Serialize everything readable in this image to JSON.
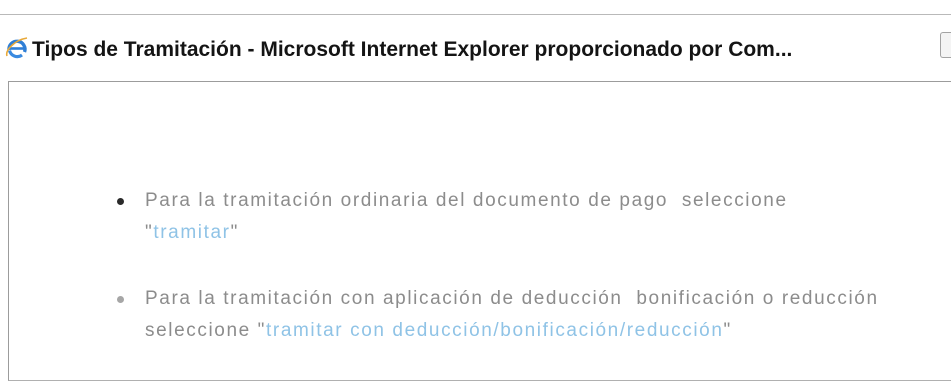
{
  "window": {
    "title": "Tipos de Tramitación - Microsoft Internet Explorer proporcionado por Com...",
    "icon": "internet-explorer-icon"
  },
  "content": {
    "items": [
      {
        "text": "Para la tramitación ordinaria del documento de pago  seleccione",
        "prefix": "\"",
        "link": "tramitar",
        "suffix": "\""
      },
      {
        "text": "Para la tramitación con aplicación de deducción  bonificación o reducción",
        "prefix": "seleccione \"",
        "link": "tramitar con deducción/bonificación/reducción",
        "suffix": "\""
      }
    ]
  },
  "colors": {
    "text": "#8c8c8c",
    "link": "#8fc3e6",
    "title": "#141414",
    "bullet_primary": "#2a2a2a",
    "bullet_secondary": "#a6a6a6"
  }
}
